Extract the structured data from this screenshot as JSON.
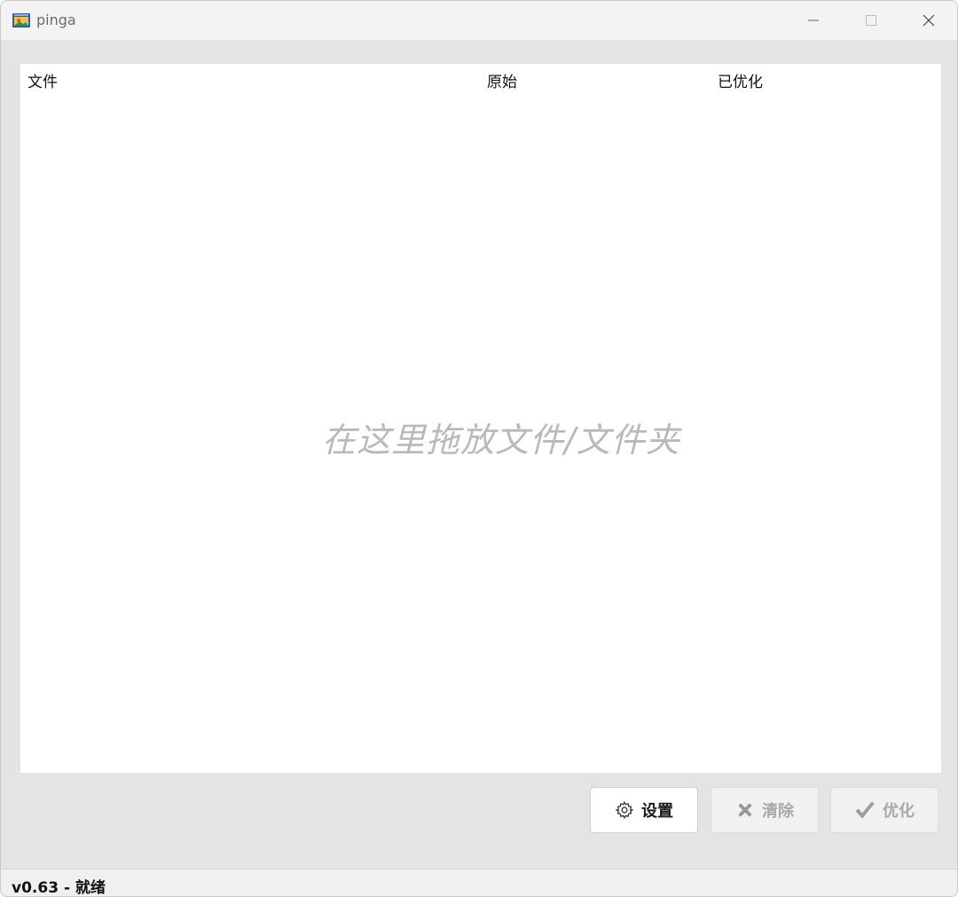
{
  "window": {
    "title": "pinga"
  },
  "list": {
    "columns": [
      {
        "label": "文件"
      },
      {
        "label": "原始"
      },
      {
        "label": "已优化"
      }
    ],
    "drop_hint": "在这里拖放文件/文件夹"
  },
  "buttons": {
    "settings": {
      "label": "设置",
      "icon": "gear-icon"
    },
    "clear": {
      "label": "清除",
      "icon": "x-icon"
    },
    "optimize": {
      "label": "优化",
      "icon": "checkmark-icon"
    }
  },
  "status": {
    "text": "v0.63 - 就绪"
  },
  "colors": {
    "window_bg": "#e4e4e4",
    "list_bg": "#ffffff",
    "hint": "#b9b9b9",
    "disabled_text": "#a9a9a9"
  }
}
